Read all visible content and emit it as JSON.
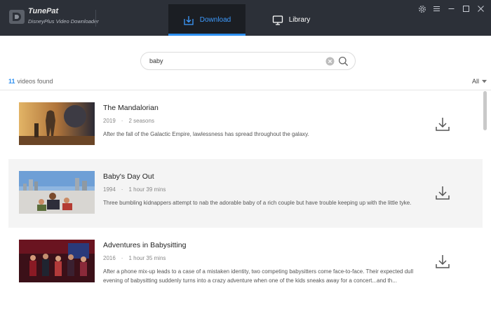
{
  "app": {
    "name": "TunePat",
    "subtitle": "DisneyPlus Video Downloader"
  },
  "tabs": [
    {
      "label": "Download",
      "icon": "download-tray-icon",
      "active": true
    },
    {
      "label": "Library",
      "icon": "monitor-icon",
      "active": false
    }
  ],
  "colors": {
    "accent": "#2d8ff0",
    "titlebar": "#2c3038",
    "active_tab": "#1b1e23"
  },
  "search": {
    "value": "baby"
  },
  "results": {
    "count": "11",
    "count_label": "videos found",
    "filter": "All"
  },
  "videos": [
    {
      "title": "The Mandalorian",
      "year": "2019",
      "duration": "2 seasons",
      "description": "After the fall of the Galactic Empire, lawlessness has spread throughout the galaxy."
    },
    {
      "title": "Baby's Day Out",
      "year": "1994",
      "duration": "1 hour 39 mins",
      "description": "Three bumbling kidnappers attempt to nab the adorable baby of a rich couple but have trouble keeping up with the little tyke."
    },
    {
      "title": "Adventures in Babysitting",
      "year": "2016",
      "duration": "1 hour 35 mins",
      "description": "After a phone mix-up leads to a case of a mistaken identity, two competing babysitters come face-to-face. Their expected dull evening of babysitting suddenly turns into a crazy adventure when one of the kids sneaks away for a concert...and th..."
    }
  ]
}
